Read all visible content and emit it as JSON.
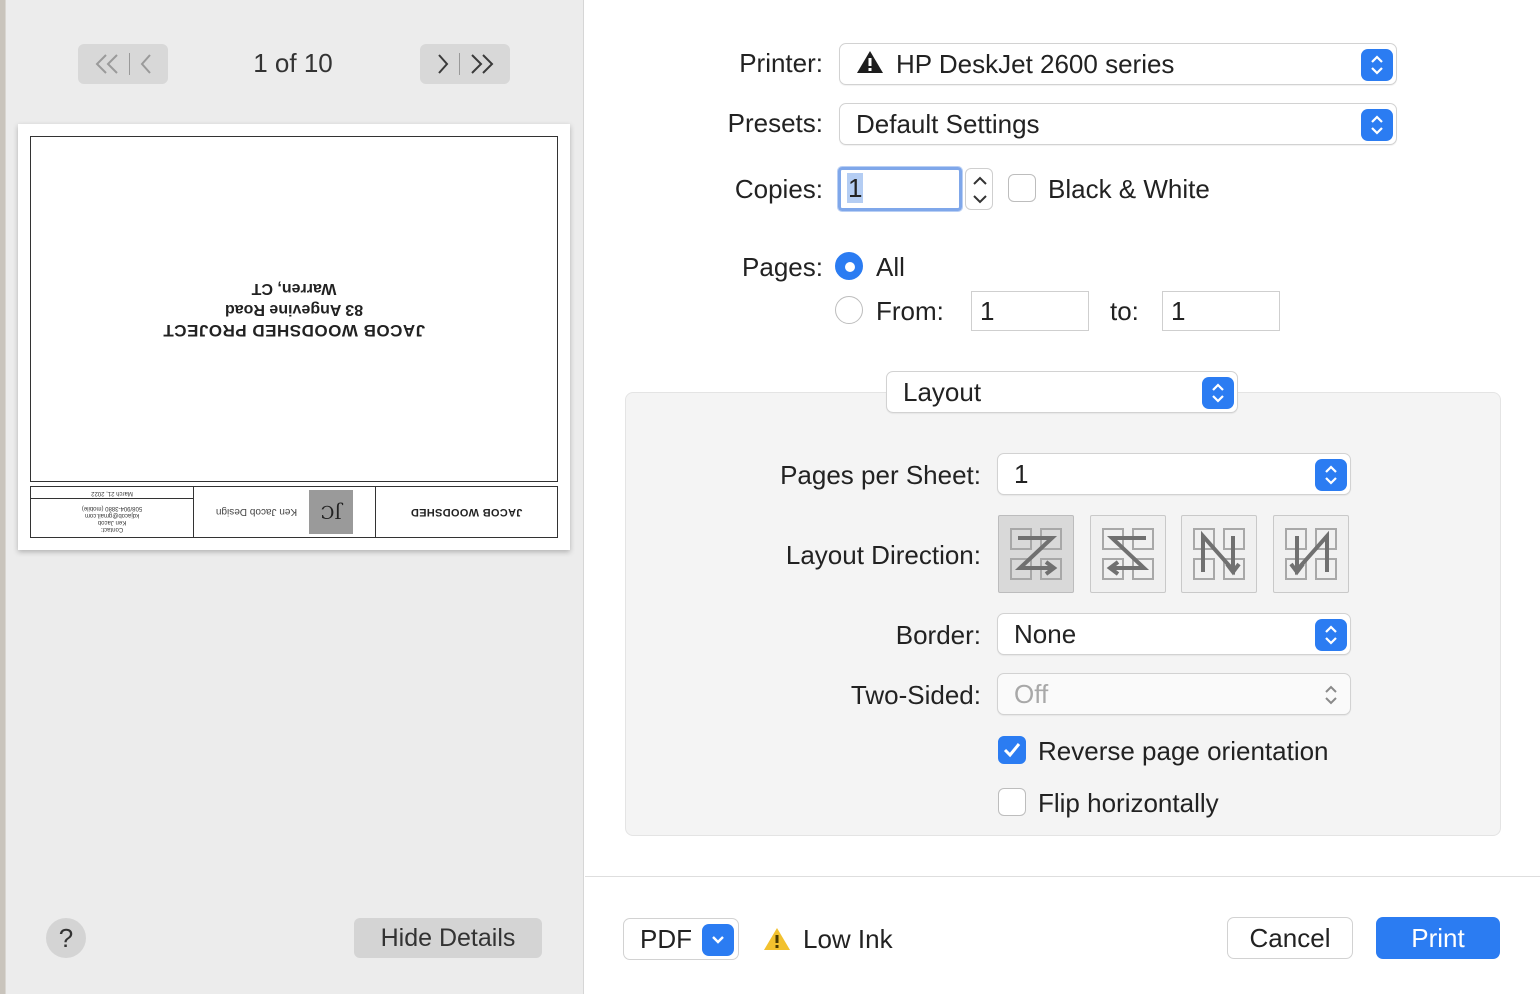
{
  "preview": {
    "page_counter": "1 of 10",
    "sheet": {
      "title_block_name": "JACOB WOODSHED",
      "logo_text": "JC",
      "designer": "Ken Jacob Design",
      "contact_lines": [
        "Contact:",
        "Ken Jacob",
        "kdjacob@gmail.com",
        "508/904-3880 (mobile)"
      ],
      "date": "March 21, 2022",
      "project_line1": "JACOB WOODSHED PROJECT",
      "project_line2": "83 Angevine Road",
      "project_line3": "Warren, CT"
    },
    "help_label": "?",
    "hide_details_label": "Hide Details"
  },
  "settings": {
    "printer_label": "Printer:",
    "printer_value": "HP DeskJet 2600 series",
    "presets_label": "Presets:",
    "presets_value": "Default Settings",
    "copies_label": "Copies:",
    "copies_value": "1",
    "black_white_label": "Black & White",
    "black_white_checked": false,
    "pages_label": "Pages:",
    "pages_all_label": "All",
    "pages_from_label": "From:",
    "pages_from_value": "1",
    "pages_to_label": "to:",
    "pages_to_value": "1",
    "section_value": "Layout",
    "pages_per_sheet_label": "Pages per Sheet:",
    "pages_per_sheet_value": "1",
    "layout_direction_label": "Layout Direction:",
    "layout_directions": [
      "z-left-right-icon",
      "reverse-z-icon",
      "n-top-bottom-icon",
      "reverse-n-icon"
    ],
    "border_label": "Border:",
    "border_value": "None",
    "two_sided_label": "Two-Sided:",
    "two_sided_value": "Off",
    "reverse_orientation_label": "Reverse page orientation",
    "reverse_orientation_checked": true,
    "flip_horizontally_label": "Flip horizontally",
    "flip_horizontally_checked": false
  },
  "footer": {
    "pdf_label": "PDF",
    "low_ink_label": "Low Ink",
    "cancel_label": "Cancel",
    "print_label": "Print"
  },
  "colors": {
    "accent": "#2b7cf2",
    "warning": "#f2c12e"
  }
}
